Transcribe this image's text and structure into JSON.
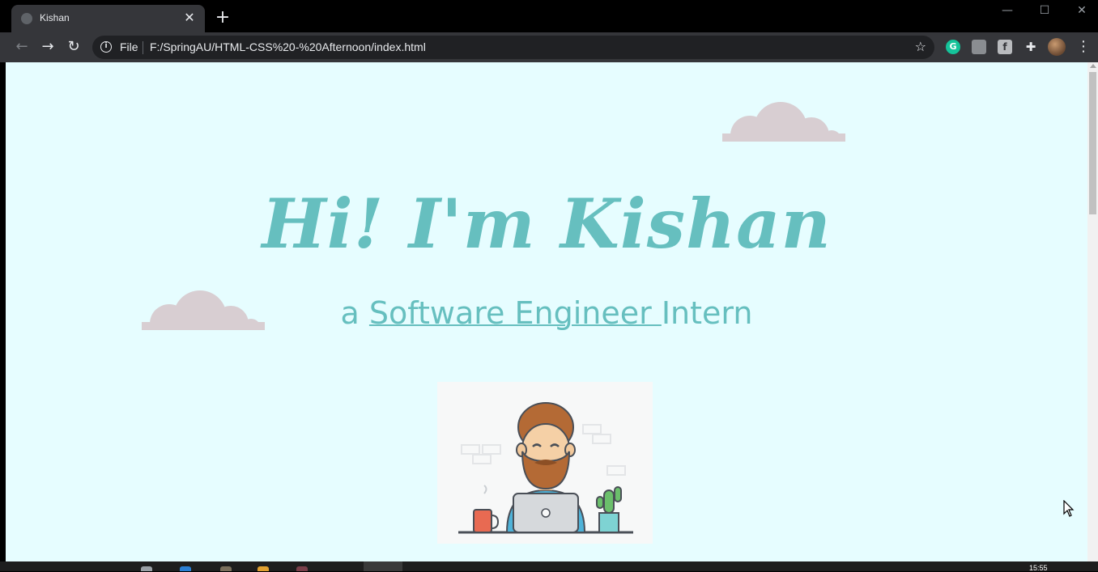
{
  "browser": {
    "tab": {
      "title": "Kishan",
      "close_glyph": "✕"
    },
    "new_tab_glyph": "+",
    "window_controls": {
      "minimize": "—",
      "maximize": "☐",
      "close": "✕"
    },
    "nav": {
      "back": "←",
      "forward": "→",
      "reload": "↻"
    },
    "address": {
      "scheme_label": "File",
      "url": "F:/SpringAU/HTML-CSS%20-%20Afternoon/index.html"
    },
    "extensions": {
      "grammarly": "G",
      "font": "f"
    },
    "star_glyph": "☆",
    "menu_glyph": "⋮",
    "puzzle_glyph": "✚"
  },
  "page": {
    "title": "Hi! I'm Kishan",
    "subtitle_prefix": "a ",
    "subtitle_link": "Software Engineer ",
    "subtitle_suffix": "Intern"
  },
  "colors": {
    "page_background": "#e6fdff",
    "accent": "#66bfbf",
    "cloud": "#d8ced2",
    "card": "#f7f8f8"
  },
  "icons": [
    "globe-icon",
    "info-icon",
    "star-icon",
    "puzzle-icon",
    "menu-icon",
    "cloud-icon",
    "cursor-icon"
  ],
  "taskbar": {
    "clock": "15:55"
  }
}
